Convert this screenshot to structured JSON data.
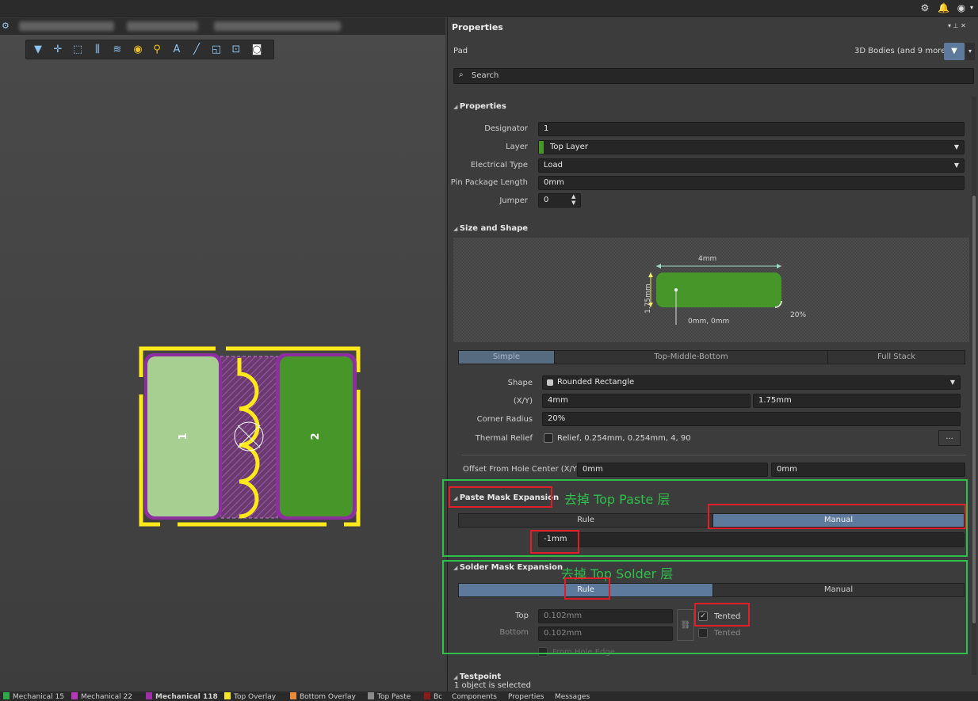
{
  "panel": {
    "title": "Properties",
    "object_type": "Pad",
    "filter_label": "3D Bodies (and 9 more)",
    "search_placeholder": "Search",
    "status": "1 object is selected"
  },
  "properties": {
    "section": "Properties",
    "designator_label": "Designator",
    "designator": "1",
    "layer_label": "Layer",
    "layer": "Top Layer",
    "electrical_type_label": "Electrical Type",
    "electrical_type": "Load",
    "pin_package_length_label": "Pin Package Length",
    "pin_package_length": "0mm",
    "jumper_label": "Jumper",
    "jumper": "0"
  },
  "size_shape": {
    "section": "Size and Shape",
    "dim_x": "4mm",
    "dim_y": "1.75mm",
    "origin": "0mm, 0mm",
    "corner": "20%",
    "tabs": [
      "Simple",
      "Top-Middle-Bottom",
      "Full Stack"
    ],
    "shape_label": "Shape",
    "shape": "Rounded Rectangle",
    "xy_label": "(X/Y)",
    "x": "4mm",
    "y": "1.75mm",
    "corner_radius_label": "Corner Radius",
    "corner_radius": "20%",
    "thermal_relief_label": "Thermal Relief",
    "thermal_relief": "Relief, 0.254mm, 0.254mm, 4, 90",
    "more": "...",
    "offset_label": "Offset From Hole Center (X/Y)",
    "offset_x": "0mm",
    "offset_y": "0mm"
  },
  "paste_mask": {
    "section": "Paste Mask Expansion",
    "annotation": "去掉  Top Paste 层",
    "rule": "Rule",
    "manual": "Manual",
    "value": "-1mm"
  },
  "solder_mask": {
    "section": "Solder Mask Expansion",
    "annotation": "去掉 Top Solder 层",
    "rule": "Rule",
    "manual": "Manual",
    "top_label": "Top",
    "top": "0.102mm",
    "bottom_label": "Bottom",
    "bottom": "0.102mm",
    "tented_top": "Tented",
    "tented_bottom": "Tented",
    "from_hole_edge": "From Hole Edge"
  },
  "testpoint": {
    "section": "Testpoint"
  },
  "pcb": {
    "pad1": "1",
    "pad2": "2"
  },
  "bottom_tabs": [
    {
      "label": "Mechanical 15",
      "color": "#2fa84a"
    },
    {
      "label": "Mechanical 22",
      "color": "#b23ab8"
    },
    {
      "label": "Mechanical 118",
      "color": "#9e2fa6"
    },
    {
      "label": "Top Overlay",
      "color": "#f5e625"
    },
    {
      "label": "Bottom Overlay",
      "color": "#e88a3a"
    },
    {
      "label": "Top Paste",
      "color": "#8a8a8a"
    },
    {
      "label": "Bc",
      "color": "#8a1b1b"
    }
  ],
  "panel_tabs": [
    "Components",
    "Properties",
    "Messages"
  ],
  "colors": {
    "accent": "#5d7a9c",
    "annotation": "#2fbf4a",
    "highlight": "#e11d2a"
  }
}
